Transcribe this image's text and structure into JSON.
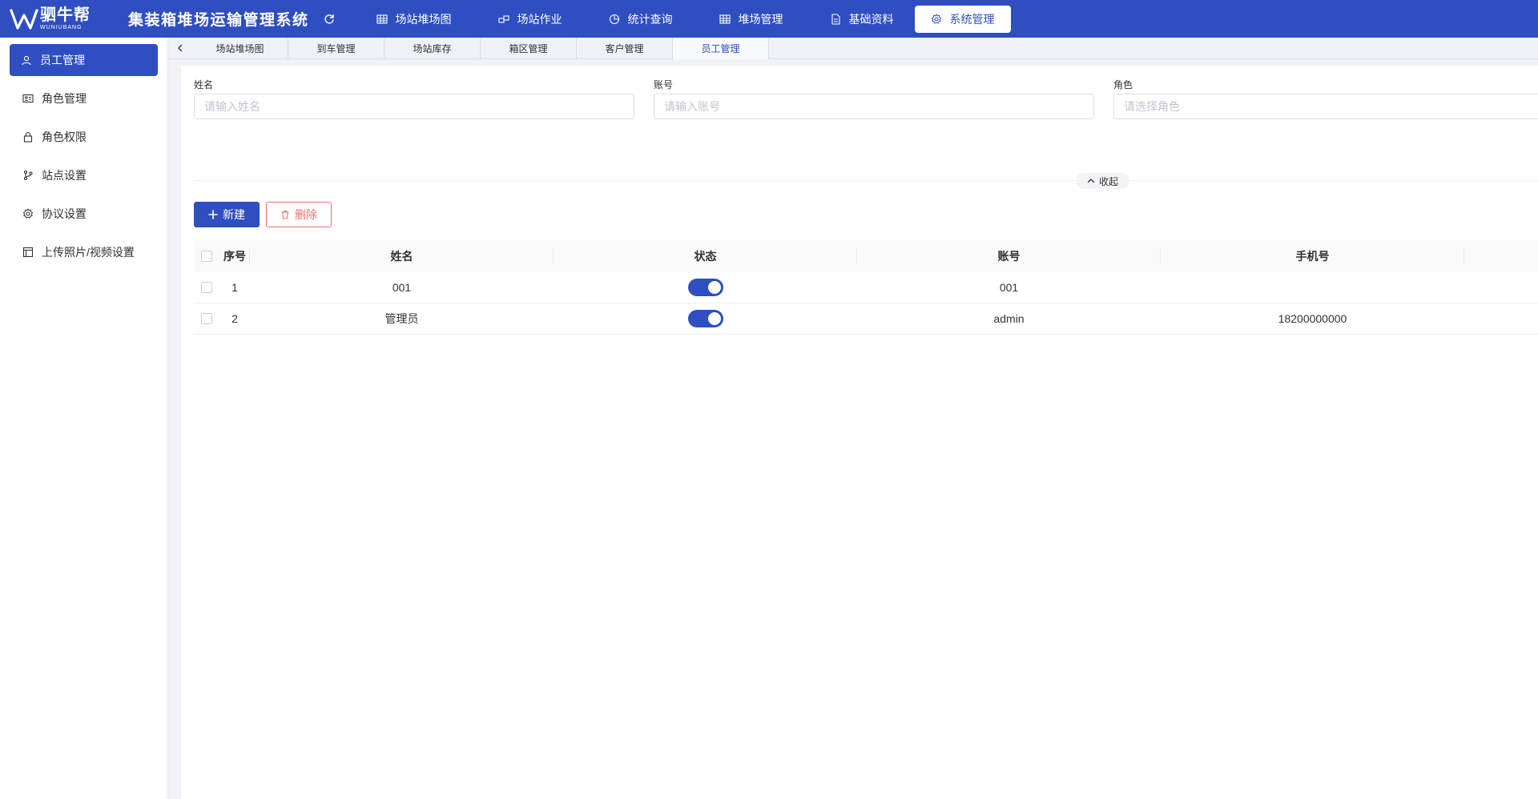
{
  "header": {
    "logo_name": "驷牛帮",
    "logo_sub": "WUNIUBANG",
    "app_title": "集装箱堆场运输管理系统",
    "nav": [
      {
        "label": "场站堆场图",
        "icon": "grid-icon"
      },
      {
        "label": "场站作业",
        "icon": "boxes-icon"
      },
      {
        "label": "统计查询",
        "icon": "pie-chart-icon"
      },
      {
        "label": "堆场管理",
        "icon": "grid-icon"
      },
      {
        "label": "基础资料",
        "icon": "document-icon"
      },
      {
        "label": "系统管理",
        "icon": "gear-icon",
        "active": true
      }
    ]
  },
  "sidebar": {
    "items": [
      {
        "label": "员工管理",
        "icon": "user-icon",
        "active": true
      },
      {
        "label": "角色管理",
        "icon": "id-card-icon"
      },
      {
        "label": "角色权限",
        "icon": "lock-icon"
      },
      {
        "label": "站点设置",
        "icon": "branch-icon"
      },
      {
        "label": "协议设置",
        "icon": "gear-icon"
      },
      {
        "label": "上传照片/视频设置",
        "icon": "layout-icon"
      }
    ]
  },
  "tabs": {
    "items": [
      {
        "label": "场站堆场图"
      },
      {
        "label": "到车管理"
      },
      {
        "label": "场站库存"
      },
      {
        "label": "箱区管理"
      },
      {
        "label": "客户管理"
      },
      {
        "label": "员工管理",
        "active": true
      }
    ]
  },
  "filters": {
    "name": {
      "label": "姓名",
      "placeholder": "请输入姓名"
    },
    "account": {
      "label": "账号",
      "placeholder": "请输入账号"
    },
    "role": {
      "label": "角色",
      "placeholder": "请选择角色"
    }
  },
  "actions": {
    "collapse_label": "收起",
    "new_label": "新建",
    "delete_label": "删除"
  },
  "table": {
    "columns": {
      "index": "序号",
      "name": "姓名",
      "status": "状态",
      "account": "账号",
      "phone": "手机号"
    },
    "rows": [
      {
        "index": "1",
        "name": "001",
        "status_on": true,
        "account": "001",
        "phone": ""
      },
      {
        "index": "2",
        "name": "管理员",
        "status_on": true,
        "account": "admin",
        "phone": "18200000000"
      }
    ]
  },
  "colors": {
    "primary": "#2f4ec1",
    "danger": "#f56c6c"
  }
}
